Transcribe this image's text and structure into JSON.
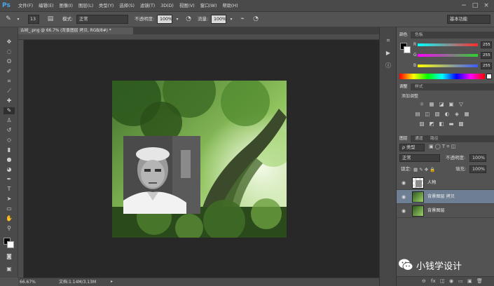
{
  "menu": {
    "logo": "Ps",
    "items": [
      "文件(F)",
      "编辑(E)",
      "图像(I)",
      "图层(L)",
      "类型(Y)",
      "选择(S)",
      "滤镜(T)",
      "3D(D)",
      "视图(V)",
      "窗口(W)",
      "帮助(H)"
    ],
    "window_controls": [
      "−",
      "□",
      "×"
    ]
  },
  "options": {
    "brush_size": "13",
    "mode_label": "模式:",
    "mode_value": "正常",
    "opacity_label": "不透明度:",
    "opacity_value": "100%",
    "flow_label": "流量:",
    "flow_value": "100%",
    "workspace": "基本功能"
  },
  "document": {
    "tab_title": "古树_.png @ 66.7% (背景图层 拷贝, RGB/8#) *",
    "zoom": "66.67%",
    "doc_info": "文档:1.14M/3.13M"
  },
  "color_panel": {
    "tabs": [
      "颜色",
      "色板"
    ],
    "channels": [
      {
        "label": "R",
        "value": "255"
      },
      {
        "label": "G",
        "value": "255"
      },
      {
        "label": "B",
        "value": "255"
      }
    ],
    "colors": {
      "r_track": "#ff2b2b",
      "g_track": "#2bd42b",
      "b_track": "#3b5bff"
    }
  },
  "adjustments_panel": {
    "tabs": [
      "调整",
      "样式"
    ],
    "title": "添加调整",
    "row1": [
      "☼",
      "▦",
      "◪",
      "▣",
      "▽"
    ],
    "row2": [
      "▤",
      "◫",
      "▧",
      "◐",
      "◈",
      "▦"
    ],
    "row3": [
      "▨",
      "◩",
      "◧",
      "▬",
      "▩"
    ]
  },
  "layers_panel": {
    "tabs": [
      "图层",
      "通道",
      "路径"
    ],
    "filter_label": "ρ 类型",
    "blend_mode": "正常",
    "opacity_label": "不透明度:",
    "opacity_value": "100%",
    "lock_label": "锁定:",
    "fill_label": "填充:",
    "fill_value": "100%",
    "layers": [
      {
        "name": "人物",
        "selected": false
      },
      {
        "name": "背景图层 拷贝",
        "selected": true
      },
      {
        "name": "背景图层",
        "selected": false
      }
    ],
    "bottom_icons": [
      "⊖",
      "fx",
      "◫",
      "◉",
      "▭",
      "▣",
      "🗑"
    ]
  },
  "watermark": {
    "text": "小钱学设计"
  }
}
